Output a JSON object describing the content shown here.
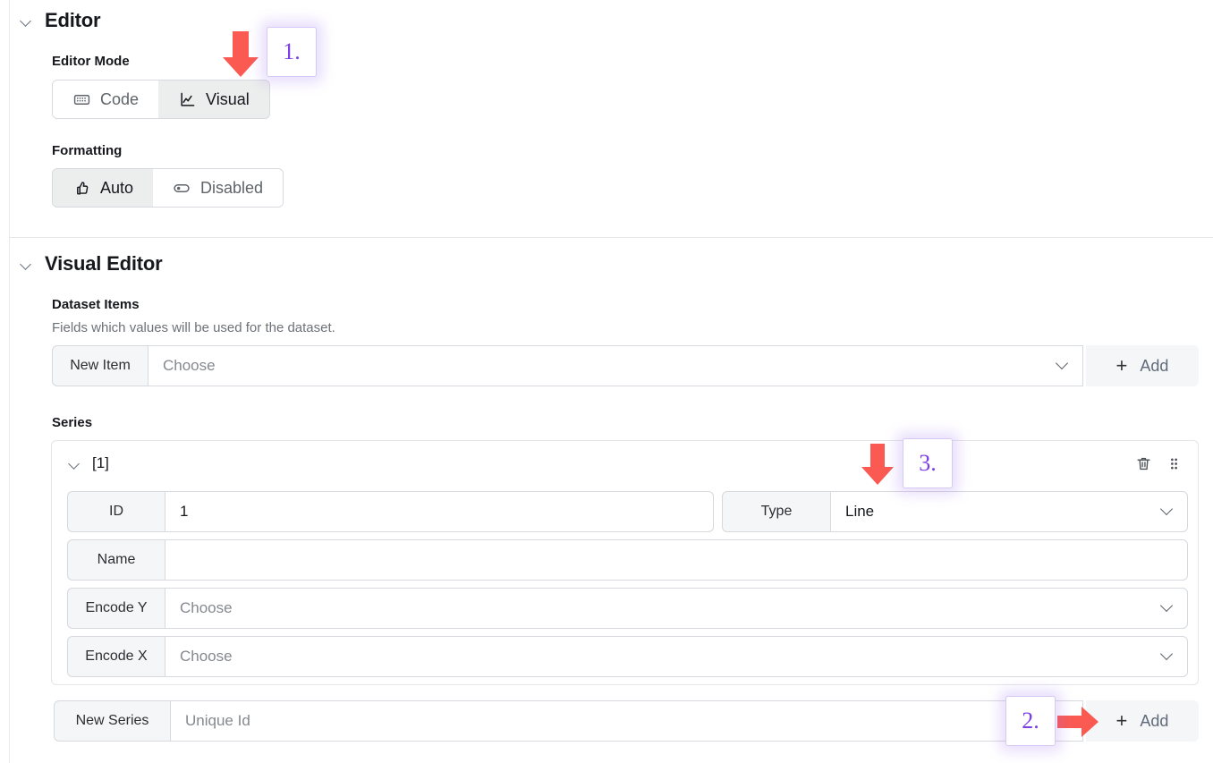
{
  "sections": {
    "editor": {
      "title": "Editor",
      "chevron_icon": "chevron-down-icon",
      "editor_mode": {
        "label": "Editor Mode",
        "options": [
          {
            "label": "Code",
            "icon": "keyboard-icon",
            "selected": false
          },
          {
            "label": "Visual",
            "icon": "line-chart-icon",
            "selected": true
          }
        ]
      },
      "formatting": {
        "label": "Formatting",
        "options": [
          {
            "label": "Auto",
            "icon": "thumbs-up-icon",
            "selected": true
          },
          {
            "label": "Disabled",
            "icon": "toggle-off-icon",
            "selected": false
          }
        ]
      }
    },
    "visual_editor": {
      "title": "Visual Editor",
      "chevron_icon": "chevron-down-icon",
      "dataset_items": {
        "label": "Dataset Items",
        "description": "Fields which values will be used for the dataset.",
        "new_item_addon": "New Item",
        "choose_placeholder": "Choose",
        "choose_value": "",
        "add_label": "Add",
        "add_icon": "plus-icon",
        "dropdown_icon": "chevron-down-icon"
      },
      "series": {
        "label": "Series",
        "items": [
          {
            "key": "[1]",
            "chevron_icon": "chevron-down-icon",
            "delete_icon": "trash-icon",
            "drag_icon": "drag-handle-icon",
            "fields": [
              {
                "label": "ID",
                "value": "1",
                "placeholder": "",
                "type": "text"
              },
              {
                "label": "Type",
                "value": "Line",
                "placeholder": "",
                "type": "select"
              },
              {
                "label": "Name",
                "value": "",
                "placeholder": "",
                "type": "text"
              },
              {
                "label": "Encode Y",
                "value": "",
                "placeholder": "Choose",
                "type": "select"
              },
              {
                "label": "Encode X",
                "value": "",
                "placeholder": "Choose",
                "type": "select"
              }
            ]
          }
        ],
        "new_series": {
          "addon": "New Series",
          "placeholder": "Unique Id",
          "value": "",
          "add_label": "Add",
          "add_icon": "plus-icon"
        }
      }
    }
  },
  "annotations": [
    {
      "badge": "1.",
      "arrow": "arrow-down-icon",
      "color": "#7c3fe4",
      "arrow_color": "#fa5a52"
    },
    {
      "badge": "2.",
      "arrow": "arrow-right-icon",
      "color": "#7c3fe4",
      "arrow_color": "#fa5a52"
    },
    {
      "badge": "3.",
      "arrow": "arrow-down-icon",
      "color": "#7c3fe4",
      "arrow_color": "#fa5a52"
    }
  ]
}
